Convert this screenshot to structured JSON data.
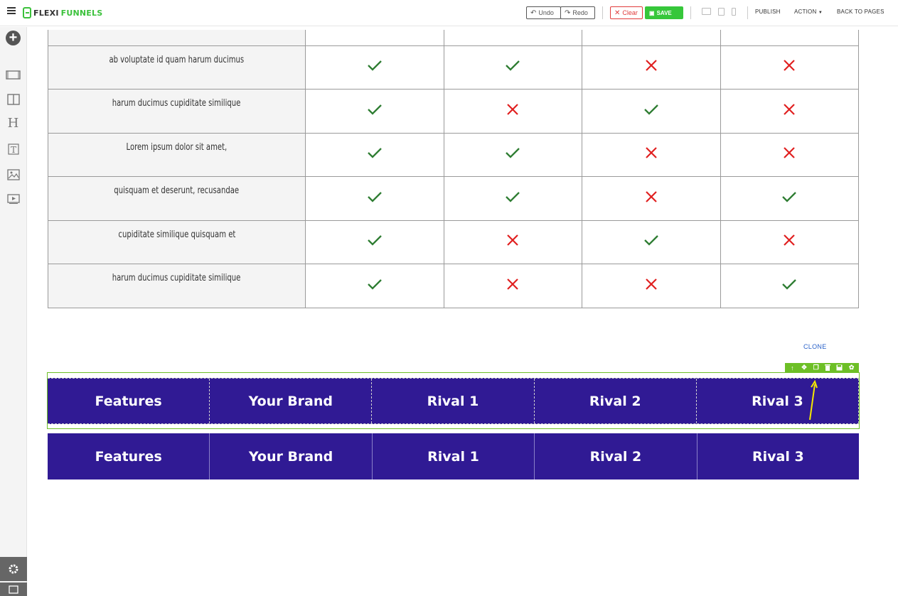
{
  "app": {
    "logo_part1": "FLEXI",
    "logo_part2": "FUNNELS"
  },
  "toolbar": {
    "undo_label": "Undo",
    "redo_label": "Redo",
    "clear_label": "Clear",
    "save_label": "SAVE",
    "publish_label": "PUBLISH",
    "action_label": "ACTION",
    "back_label": "BACK TO PAGES"
  },
  "sidebar": {
    "items": [
      "add-icon",
      "section-icon",
      "columns-icon",
      "heading-icon",
      "text-icon",
      "image-icon",
      "video-icon"
    ],
    "bottom": [
      "settings-icon",
      "code-icon"
    ]
  },
  "comparison": {
    "rows": [
      {
        "feature": "ab voluptate id quam harum ducimus",
        "marks": [
          "check",
          "check",
          "cross",
          "cross"
        ]
      },
      {
        "feature": "harum ducimus cupiditate similique",
        "marks": [
          "check",
          "cross",
          "check",
          "cross"
        ]
      },
      {
        "feature": "Lorem ipsum dolor sit amet,",
        "marks": [
          "check",
          "check",
          "cross",
          "cross"
        ]
      },
      {
        "feature": "quisquam et deserunt, recusandae",
        "marks": [
          "check",
          "check",
          "cross",
          "check"
        ]
      },
      {
        "feature": "cupiditate similique quisquam et",
        "marks": [
          "check",
          "cross",
          "check",
          "cross"
        ]
      },
      {
        "feature": "harum ducimus cupiditate similique",
        "marks": [
          "check",
          "cross",
          "cross",
          "check"
        ]
      }
    ],
    "colors": {
      "check": "#2e7d32",
      "cross": "#e02020"
    }
  },
  "clone_label": "CLONE",
  "header_selected": [
    "Features",
    "Your Brand",
    "Rival 1",
    "Rival 2",
    "Rival 3"
  ],
  "header_copy": [
    "Features",
    "Your Brand",
    "Rival 1",
    "Rival 2",
    "Rival 3"
  ],
  "colors": {
    "header_bg": "#301a94",
    "accent_green": "#6dbf26",
    "save_green": "#36c73a"
  }
}
